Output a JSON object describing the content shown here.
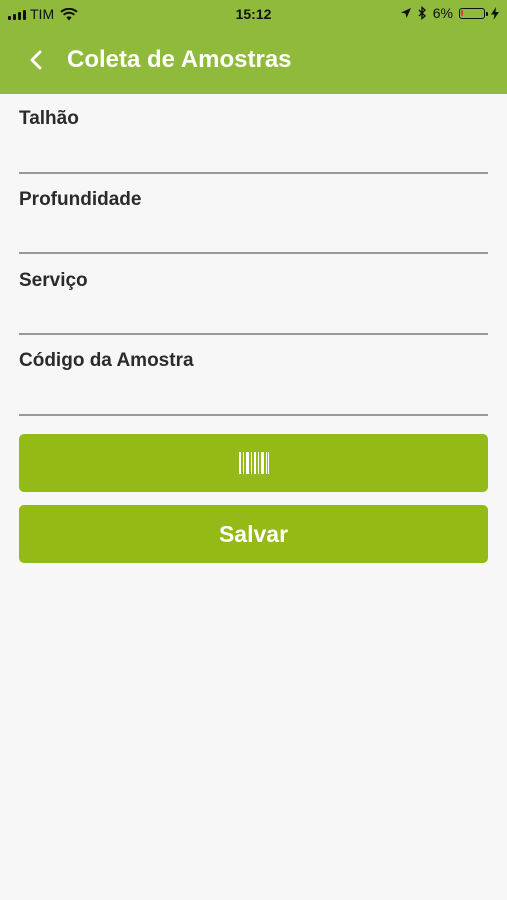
{
  "status_bar": {
    "carrier": "TIM",
    "time": "15:12",
    "battery_percent": "6%",
    "battery_level": 0.06,
    "icons": [
      "signal-icon",
      "wifi-icon",
      "location-arrow-icon",
      "bluetooth-icon",
      "battery-icon",
      "charging-bolt-icon"
    ]
  },
  "header": {
    "title": "Coleta de Amostras",
    "back_icon": "chevron-left-icon"
  },
  "form": {
    "fields": [
      {
        "label": "Talhão",
        "value": ""
      },
      {
        "label": "Profundidade",
        "value": ""
      },
      {
        "label": "Serviço",
        "value": ""
      },
      {
        "label": "Código da Amostra",
        "value": ""
      }
    ]
  },
  "buttons": {
    "scan_icon": "barcode-icon",
    "save_label": "Salvar"
  },
  "colors": {
    "header": "#8fba3b",
    "button": "#93ba17",
    "background": "#f7f7f7"
  }
}
